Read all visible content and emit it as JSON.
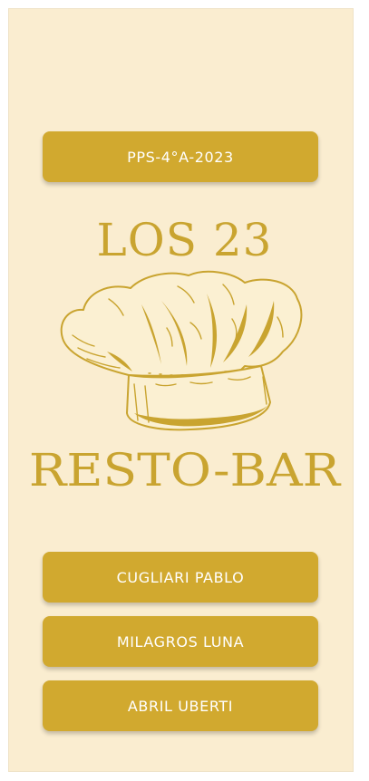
{
  "header": {
    "badge_label": "PPS-4°A-2023"
  },
  "brand": {
    "title_top": "LOS 23",
    "title_bottom": "RESTO-BAR",
    "logo_icon": "chef-hat-icon"
  },
  "members": [
    {
      "label": "CUGLIARI PABLO"
    },
    {
      "label": "MILAGROS LUNA"
    },
    {
      "label": "ABRIL UBERTI"
    }
  ],
  "colors": {
    "accent": "#d1a92f",
    "background": "#faedd0",
    "title": "#c9a430",
    "hat_fill": "#fbf0d2"
  }
}
